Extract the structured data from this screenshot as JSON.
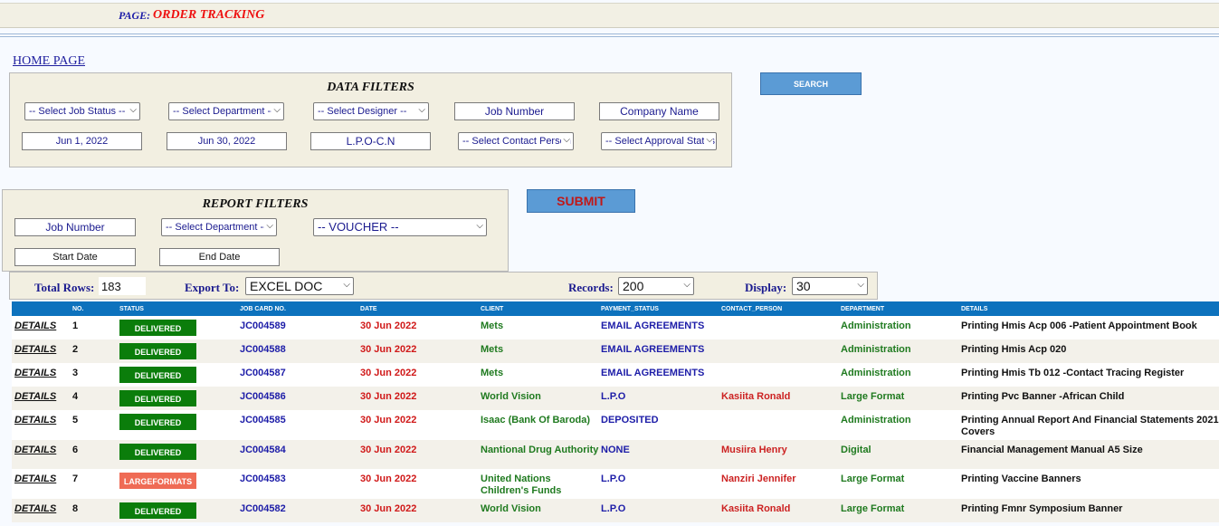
{
  "header": {
    "page_label": "PAGE:",
    "page_name": "ORDER TRACKING"
  },
  "home_link": "HOME PAGE",
  "data_filters": {
    "title": "DATA FILTERS",
    "job_status": "-- Select Job Status --",
    "department": "-- Select Department --",
    "designer": "-- Select Designer --",
    "job_number": "Job Number",
    "company_name": "Company Name",
    "start_date": "Jun 1, 2022",
    "end_date": "Jun 30, 2022",
    "lpo": "L.P.O-C.N",
    "contact_person": "-- Select Contact Person --",
    "approval_status": "-- Select Approval Status --"
  },
  "search_button": "SEARCH",
  "report_filters": {
    "title": "REPORT FILTERS",
    "job_number": "Job Number",
    "department": "-- Select Department --",
    "voucher": "-- VOUCHER --",
    "start_date": "Start Date",
    "end_date": "End Date"
  },
  "submit_button": "SUBMIT",
  "grid": {
    "total_rows_label": "Total Rows:",
    "total_rows_value": "183",
    "export_label": "Export To:",
    "export_value": "EXCEL DOC",
    "records_label": "Records:",
    "records_value": "200",
    "display_label": "Display:",
    "display_value": "30"
  },
  "table": {
    "columns": [
      "NO.",
      "STATUS",
      "JOB CARD NO.",
      "DATE",
      "CLIENT",
      "PAYMENT_STATUS",
      "CONTACT_PERSON",
      "DEPARTMENT",
      "DETAILS"
    ],
    "details_link": "DETAILS",
    "rows": [
      {
        "no": "1",
        "status": "DELIVERED",
        "job": "JC004589",
        "date": "30 Jun 2022",
        "client": "Mets",
        "payment": "EMAIL AGREEMENTS",
        "contact": "",
        "department": "Administration",
        "details": "Printing Hmis Acp 006 -Patient Appointment Book"
      },
      {
        "no": "2",
        "status": "DELIVERED",
        "job": "JC004588",
        "date": "30 Jun 2022",
        "client": "Mets",
        "payment": "EMAIL AGREEMENTS",
        "contact": "",
        "department": "Administration",
        "details": "Printing Hmis Acp 020"
      },
      {
        "no": "3",
        "status": "DELIVERED",
        "job": "JC004587",
        "date": "30 Jun 2022",
        "client": "Mets",
        "payment": "EMAIL AGREEMENTS",
        "contact": "",
        "department": "Administration",
        "details": "Printing Hmis Tb 012 -Contact Tracing Register"
      },
      {
        "no": "4",
        "status": "DELIVERED",
        "job": "JC004586",
        "date": "30 Jun 2022",
        "client": "World Vision",
        "payment": "L.P.O",
        "contact": "Kasiita Ronald",
        "department": "Large Format",
        "details": "Printing Pvc Banner -African Child"
      },
      {
        "no": "5",
        "status": "DELIVERED",
        "job": "JC004585",
        "date": "30 Jun 2022",
        "client": "Isaac (Bank Of Baroda)",
        "payment": "DEPOSITED",
        "contact": "",
        "department": "Administration",
        "details": "Printing Annual Report And Financial Statements 2021 Covers"
      },
      {
        "no": "6",
        "status": "DELIVERED",
        "job": "JC004584",
        "date": "30 Jun 2022",
        "client": "Nantional Drug Authority",
        "payment": "NONE",
        "contact": "Musiira Henry",
        "department": "Digital",
        "details": "Financial Management Manual A5 Size"
      },
      {
        "no": "7",
        "status": "LARGEFORMATS",
        "job": "JC004583",
        "date": "30 Jun 2022",
        "client": "United Nations Children's Funds",
        "payment": "L.P.O",
        "contact": "Nanziri Jennifer",
        "department": "Large Format",
        "details": "Printing Vaccine Banners"
      },
      {
        "no": "8",
        "status": "DELIVERED",
        "job": "JC004582",
        "date": "30 Jun 2022",
        "client": "World Vision",
        "payment": "L.P.O",
        "contact": "Kasiita Ronald",
        "department": "Large Format",
        "details": "Printing Fmnr Symposium Banner"
      }
    ]
  },
  "colors": {
    "delivered": "#0b7d0b",
    "largeformats": "#ef6b55",
    "header_blue": "#0d72bd",
    "button_blue": "#5b9bd5"
  },
  "icons": {
    "dropdown": "chevron-down-icon"
  }
}
